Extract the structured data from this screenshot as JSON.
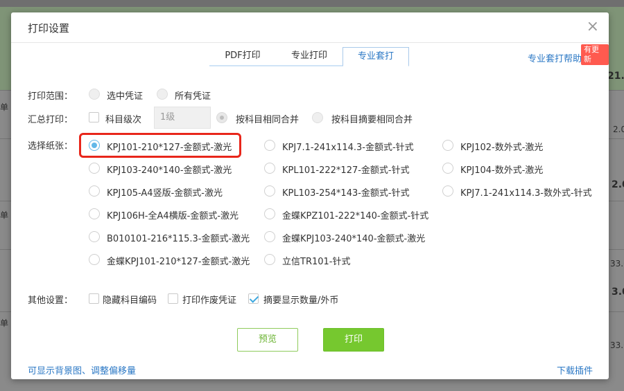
{
  "background": {
    "snippets": [
      "单",
      "21.0",
      "2.0",
      "2.0",
      "单",
      "33.0",
      "3.0",
      "单",
      "33.0"
    ]
  },
  "dialog": {
    "title": "打印设置",
    "close": "×"
  },
  "tabs": [
    "PDF打印",
    "专业打印",
    "专业套打"
  ],
  "help": {
    "link": "专业套打帮助",
    "badge": "有更新"
  },
  "print_range": {
    "label": "打印范围：",
    "options": [
      "选中凭证",
      "所有凭证"
    ]
  },
  "summary_print": {
    "label": "汇总打印：",
    "subject_level": "科目级次",
    "level_value": "1级",
    "merge_options": [
      "按科目相同合并",
      "按科目摘要相同合并"
    ]
  },
  "paper": {
    "label": "选择纸张：",
    "col1": [
      "KPJ101-210*127-金额式-激光",
      "KPJ103-240*140-金额式-激光",
      "KPJ105-A4竖版-金额式-激光",
      "KPJ106H-全A4横版-金额式-激光",
      "B010101-216*115.3-金额式-激光",
      "金蝶KPJ101-210*127-金额式-激光"
    ],
    "col2": [
      "KPJ7.1-241x114.3-金额式-针式",
      "KPL101-222*127-金额式-针式",
      "KPL103-254*143-金额式-针式",
      "金蝶KPZ101-222*140-金额式-针式",
      "金蝶KPJ103-240*140-金额式-激光",
      "立信TR101-针式"
    ],
    "col3": [
      "KPJ102-数外式-激光",
      "KPJ104-数外式-激光",
      "KPJ7.1-241x114.3-数外式-针式"
    ]
  },
  "other": {
    "label": "其他设置：",
    "options": [
      "隐藏科目编码",
      "打印作废凭证",
      "摘要显示数量/外币"
    ]
  },
  "buttons": {
    "preview": "预览",
    "print": "打印"
  },
  "footer": {
    "left": "可显示背景图、调整偏移量",
    "right": "下载插件"
  },
  "colors": {
    "accent": "#2b78c5",
    "primary_button": "#76c82f",
    "highlight": "#e8261b",
    "radio_checked": "#62b8e8"
  }
}
